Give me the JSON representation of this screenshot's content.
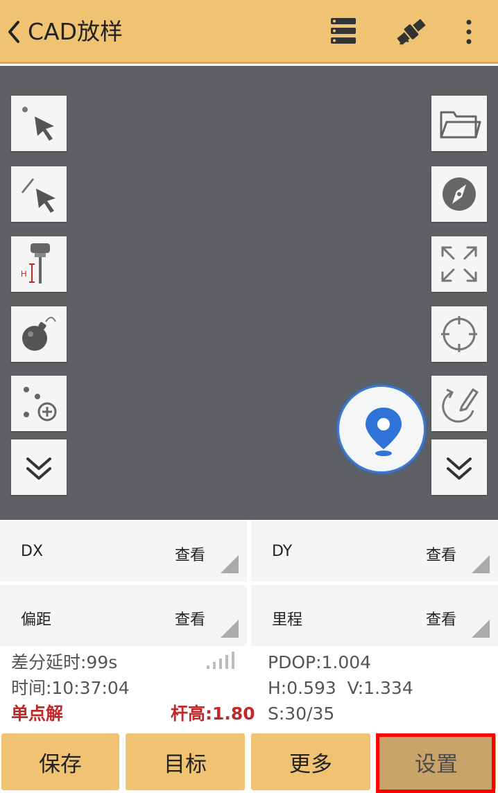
{
  "header": {
    "title": "CAD放样"
  },
  "cells": [
    {
      "label": "DX",
      "action": "查看"
    },
    {
      "label": "DY",
      "action": "查看"
    },
    {
      "label": "偏距",
      "action": "查看"
    },
    {
      "label": "里程",
      "action": "查看"
    }
  ],
  "status": {
    "diff_delay": "差分延时:99s",
    "time": "时间:10:37:04",
    "solution": "单点解",
    "pole_height": "杆高:1.80",
    "pdop": "PDOP:1.004",
    "hv": "H:0.593  V:1.334",
    "satellites": "S:30/35"
  },
  "bottom_buttons": [
    "保存",
    "目标",
    "更多",
    "设置"
  ],
  "colors": {
    "header": "#efc372",
    "map": "#5f6063",
    "accent": "#2f72d8",
    "alert": "#c0282a",
    "highlight": "#ff0000"
  },
  "icons": {
    "left_tools": [
      "point-select-icon",
      "line-select-icon",
      "antenna-height-icon",
      "bomb-icon",
      "add-point-icon",
      "expand-down-icon"
    ],
    "right_tools": [
      "folder-icon",
      "compass-icon",
      "zoom-extent-icon",
      "crosshair-icon",
      "rotate-draw-icon",
      "expand-down-icon"
    ]
  }
}
